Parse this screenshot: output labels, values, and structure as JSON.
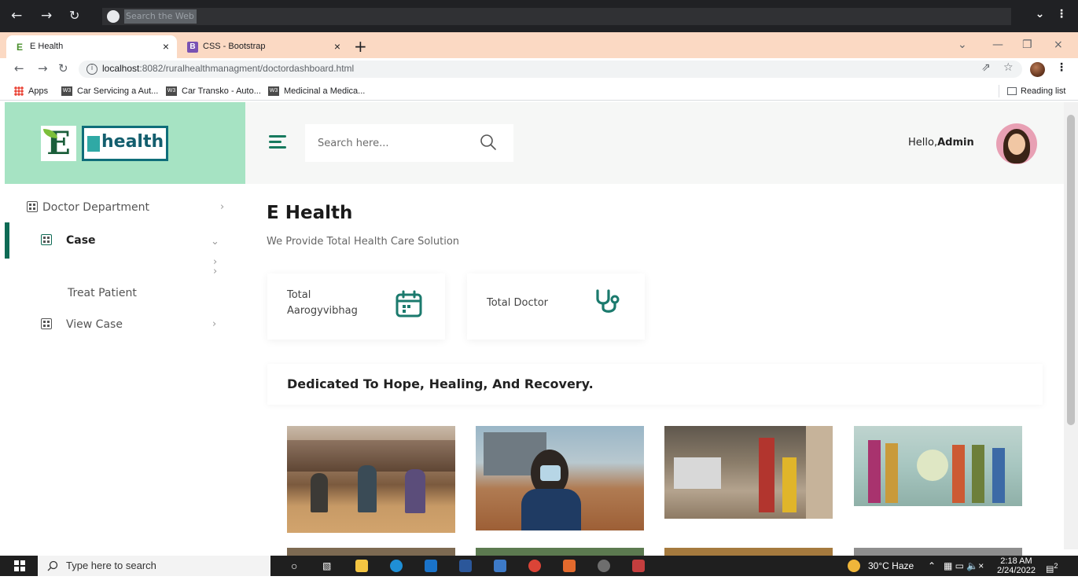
{
  "browser": {
    "topbar_search_placeholder": "Search the Web",
    "tabs": [
      {
        "title": "E Health",
        "active": true
      },
      {
        "title": "CSS - Bootstrap",
        "active": false
      }
    ],
    "url_host": "localhost",
    "url_rest": ":8082/ruralhealthmanagment/doctordashboard.html",
    "bookmarks": [
      {
        "label": "Apps"
      },
      {
        "label": "Car Servicing a Aut..."
      },
      {
        "label": "Car Transko - Auto..."
      },
      {
        "label": "Medicinal a Medica..."
      }
    ],
    "reading_list": "Reading list"
  },
  "app": {
    "logo_text": "health",
    "search_placeholder": "Search here...",
    "greeting": "Hello,",
    "user": "Admin",
    "accent_color": "#0e6b55",
    "header_bg": "#a6e3c3"
  },
  "sidebar": {
    "department": "Doctor Department",
    "case": "Case",
    "treat_patient": "Treat Patient",
    "view_case": "View Case"
  },
  "main": {
    "title": "E Health",
    "subtitle": "We Provide Total Health Care Solution",
    "stats": [
      {
        "label": "Total Aarogyvibhag",
        "icon": "calendar-icon"
      },
      {
        "label": "Total Doctor",
        "icon": "stethoscope-icon"
      }
    ],
    "banner": "Dedicated To Hope, Healing, And Recovery."
  },
  "taskbar": {
    "search": "Type here to search",
    "weather": "30°C  Haze",
    "time": "2:18 AM",
    "date": "2/24/2022",
    "notifications": "2"
  }
}
